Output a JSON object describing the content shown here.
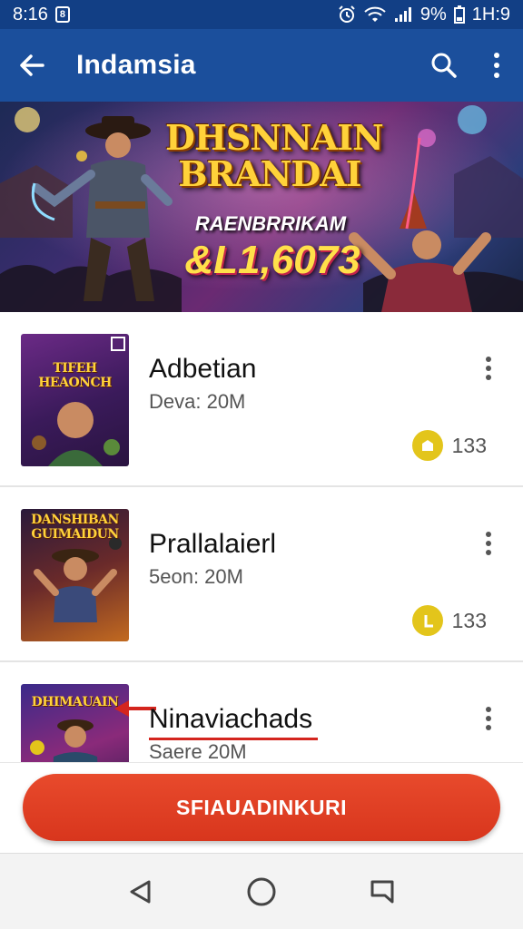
{
  "status_bar": {
    "time": "8:16",
    "battery_text": "9%",
    "clock_right": "1H:9",
    "icons": [
      "app-badge-icon",
      "alarm-icon",
      "wifi-icon",
      "signal-icon",
      "battery-icon"
    ]
  },
  "app_bar": {
    "title": "Indamsia",
    "icons": [
      "back-arrow-icon",
      "search-icon",
      "more-vertical-icon"
    ]
  },
  "banner": {
    "title": "DHSNNAIN BRANDAI",
    "subtitle": "RAENBRRIKAM",
    "number": "&L1,6073"
  },
  "list": {
    "items": [
      {
        "thumb_text": "TIFEH HEAONCH",
        "title": "Adbetian",
        "meta": "Deva: 20M",
        "rating": "133"
      },
      {
        "thumb_text": "DANSHIBAN GUIMAIDUN",
        "title": "Prallalaierl",
        "meta": "5eon: 20M",
        "rating": "133"
      },
      {
        "thumb_text": "DHIMAUAIN",
        "title": "Ninaviachads",
        "meta": "Saere 20M",
        "rating": ""
      }
    ]
  },
  "cta": {
    "label": "SFIAUADINKURI"
  },
  "nav_bar": {
    "icons": [
      "nav-back-icon",
      "nav-home-icon",
      "nav-recents-icon"
    ]
  },
  "colors": {
    "status_bar": "#123f85",
    "app_bar": "#1b4f9c",
    "cta": "#e0402a",
    "coin": "#e3c51b",
    "accent_red": "#d4251e"
  }
}
